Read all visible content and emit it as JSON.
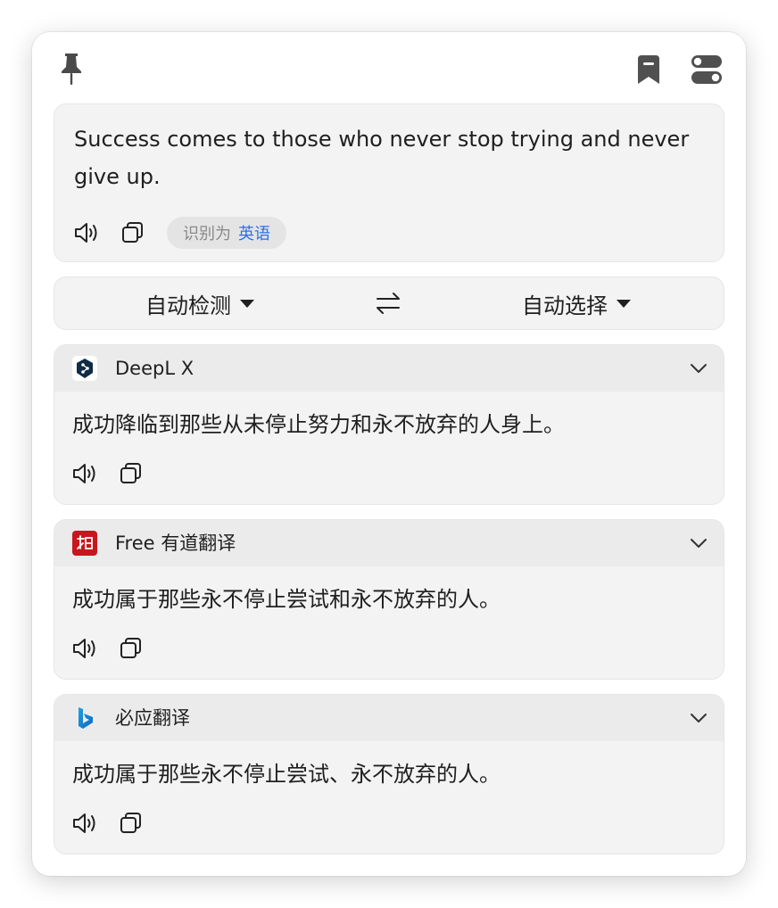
{
  "toolbar": {
    "pin_icon": "pin-icon",
    "bookmark_icon": "bookmark-icon",
    "settings_icon": "toggle-settings-icon"
  },
  "source": {
    "text": "Success comes to those who never stop trying and never give up.",
    "detected_prefix": "识别为",
    "detected_language": "英语"
  },
  "language_bar": {
    "from": "自动检测",
    "to": "自动选择"
  },
  "results": [
    {
      "service": "DeepL X",
      "logo": "deepl-logo",
      "translation": "成功降临到那些从未停止努力和永不放弃的人身上。"
    },
    {
      "service": "Free 有道翻译",
      "logo": "youdao-logo",
      "translation": "成功属于那些永不停止尝试和永不放弃的人。"
    },
    {
      "service": "必应翻译",
      "logo": "bing-logo",
      "translation": "成功属于那些永不停止尝试、永不放弃的人。"
    }
  ],
  "colors": {
    "accent_blue": "#2f6fe8",
    "card_bg": "#f3f3f3",
    "header_bg": "#ebebeb",
    "youdao_red": "#c8161d",
    "deepl_navy": "#0f2b46"
  }
}
